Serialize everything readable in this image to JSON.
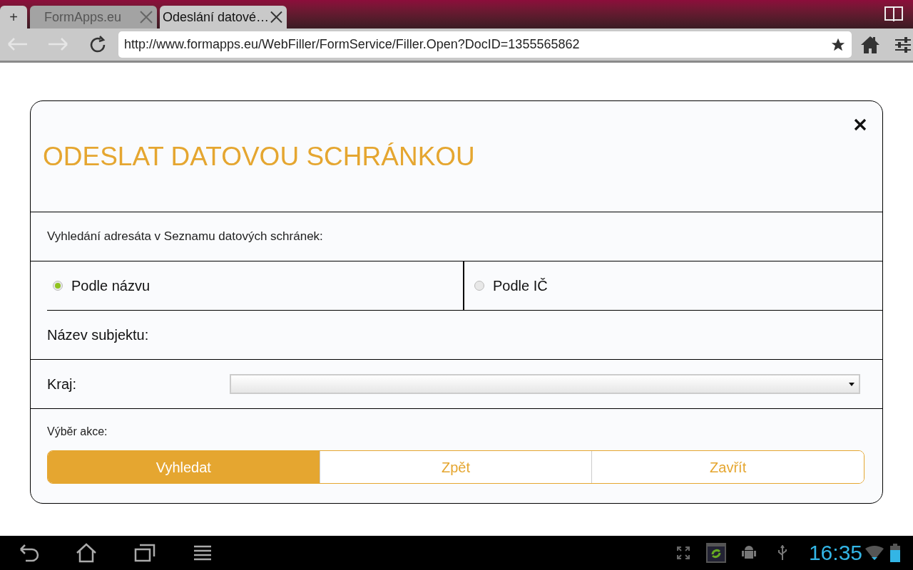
{
  "browser": {
    "tabs": [
      {
        "kind": "new",
        "label": "+"
      },
      {
        "kind": "page",
        "label": "FormApps.eu",
        "selected": false
      },
      {
        "kind": "page",
        "label": "Odeslání datové…",
        "selected": true
      }
    ],
    "nav_buttons": [
      {
        "kind": "back",
        "disabled": true
      },
      {
        "kind": "forward",
        "disabled": true
      },
      {
        "kind": "reload",
        "disabled": false
      }
    ],
    "address": "http://www.formapps.eu/WebFiller/FormService/Filler.Open?DocID=1355565862"
  },
  "dialog": {
    "title": "ODESLAT DATOVOU SCHRÁNKOU",
    "section_label": "Vyhledání adresáta v Seznamu datových schránek:",
    "search_modes": [
      {
        "label": "Podle názvu",
        "selected": true
      },
      {
        "label": "Podle IČ",
        "selected": false
      }
    ],
    "fields": [
      {
        "kind": "text",
        "label": "Název subjektu:"
      },
      {
        "kind": "select",
        "label": "Kraj:"
      }
    ],
    "actions_label": "Výběr akce:",
    "actions": [
      {
        "label": "Vyhledat",
        "selected": true
      },
      {
        "label": "Zpět",
        "selected": false
      },
      {
        "label": "Zavřít",
        "selected": false
      }
    ]
  },
  "system_bar": {
    "clock": "16:35"
  }
}
